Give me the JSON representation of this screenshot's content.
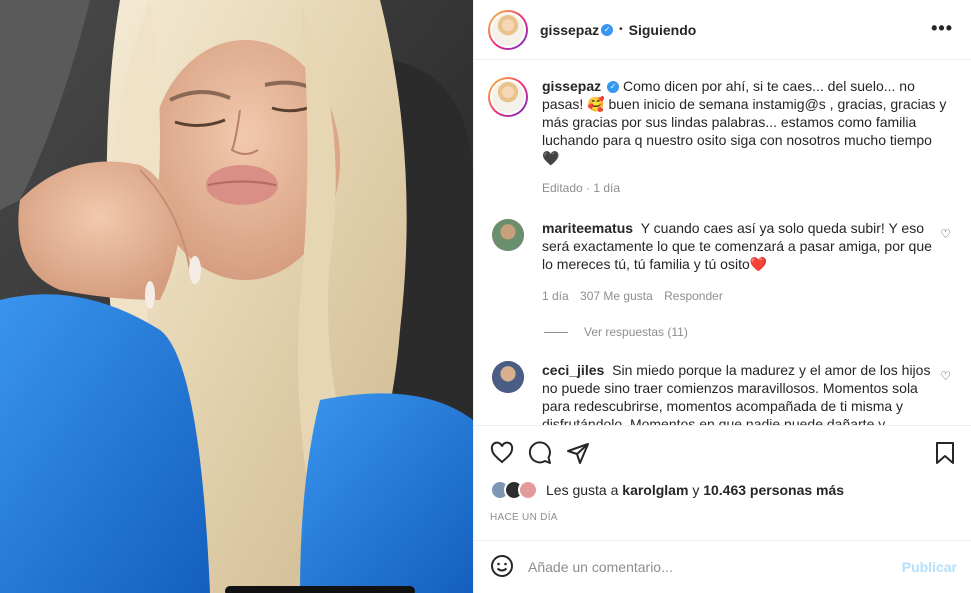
{
  "post": {
    "username": "gissepaz",
    "follow_status": "Siguiendo",
    "separator": "•",
    "more_glyph": "•••"
  },
  "caption": {
    "username": "gissepaz",
    "text": "Como dicen por ahí, si te caes... del suelo... no pasas! 🥰 buen inicio de semana instamig@s , gracias, gracias y más gracias por sus lindas palabras... estamos como familia luchando para q nuestro osito siga con nosotros mucho tiempo 🖤",
    "meta": "Editado · 1 día"
  },
  "comments": [
    {
      "username": "mariteematus",
      "text": "Y cuando caes así ya solo queda subir! Y eso será exactamente lo que te comenzará a pasar amiga, por que lo mereces tú, tú familia y tú osito❤️",
      "time": "1 día",
      "likes": "307 Me gusta",
      "reply": "Responder",
      "view_replies": "Ver respuestas (11)"
    },
    {
      "username": "ceci_jiles",
      "text": "Sin miedo porque la madurez y el amor de los hijos no puede sino traer comienzos maravillosos. Momentos sola para redescubrirse, momentos acompañada de ti misma y disfrutándolo. Momentos en que nadie puede dañarte y"
    }
  ],
  "likes": {
    "prefix": "Les gusta a",
    "user": "karolglam",
    "joiner": "y",
    "rest": "10.463 personas más"
  },
  "time_ago": "HACE UN DÍA",
  "add_comment": {
    "placeholder": "Añade un comentario...",
    "publish": "Publicar"
  },
  "colors": {
    "verified": "#3897f0",
    "shirt": "#1f78d8",
    "hair": "#e9dcc0",
    "publish": "#b2dffc",
    "heart": "#e0245e"
  },
  "icons": [
    "verified-badge-icon",
    "more-options-icon",
    "like-icon",
    "comment-icon",
    "share-icon",
    "save-icon",
    "emoji-icon",
    "small-heart-icon"
  ]
}
